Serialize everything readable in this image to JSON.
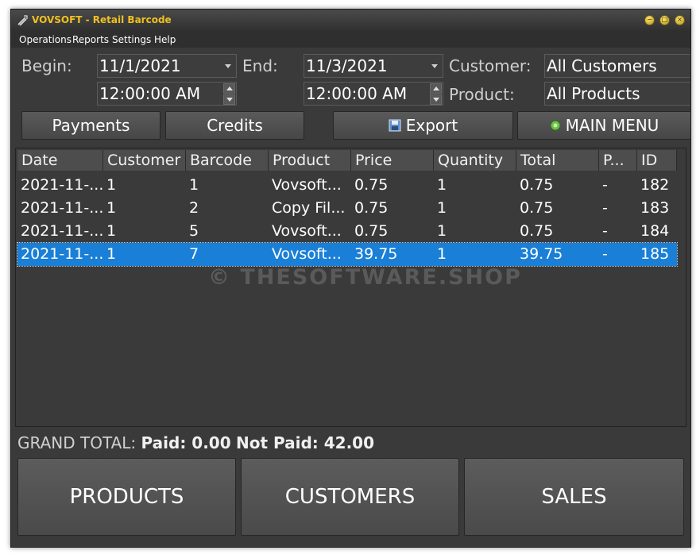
{
  "window": {
    "title": "VOVSOFT - Retail Barcode"
  },
  "menu": {
    "items": [
      "Operations",
      "Reports",
      "Settings",
      "Help"
    ]
  },
  "filters": {
    "begin_label": "Begin:",
    "begin_date": "11/1/2021",
    "begin_time": "12:00:00 AM",
    "end_label": "End:",
    "end_date": "11/3/2021",
    "end_time": "12:00:00 AM",
    "customer_label": "Customer:",
    "customer_value": "All Customers",
    "product_label": "Product:",
    "product_value": "All Products"
  },
  "buttons": {
    "payments": "Payments",
    "credits": "Credits",
    "export": "Export",
    "main_menu": "MAIN MENU"
  },
  "table": {
    "columns": [
      "Date",
      "Customer",
      "Barcode",
      "Product",
      "Price",
      "Quantity",
      "Total",
      "P...",
      "ID"
    ],
    "rows": [
      [
        "2021-11-...",
        "1",
        "1",
        "Vovsoft...",
        "0.75",
        "1",
        "0.75",
        "-",
        "182"
      ],
      [
        "2021-11-...",
        "1",
        "2",
        "Copy Fil...",
        "0.75",
        "1",
        "0.75",
        "-",
        "183"
      ],
      [
        "2021-11-...",
        "1",
        "5",
        "Vovsoft...",
        "0.75",
        "1",
        "0.75",
        "-",
        "184"
      ],
      [
        "2021-11-...",
        "1",
        "7",
        "Vovsoft...",
        "39.75",
        "1",
        "39.75",
        "-",
        "185"
      ]
    ],
    "selected_row": 3
  },
  "watermark": "© THESOFTWARE.SHOP",
  "totals": {
    "label": "GRAND TOTAL:",
    "paid": "Paid: 0.00",
    "not_paid": "Not Paid: 42.00"
  },
  "nav": {
    "products": "PRODUCTS",
    "customers": "CUSTOMERS",
    "sales": "SALES"
  },
  "colors": {
    "title_accent": "#f0c020",
    "selection": "#1a7fd6",
    "background": "#3a3a3a"
  }
}
